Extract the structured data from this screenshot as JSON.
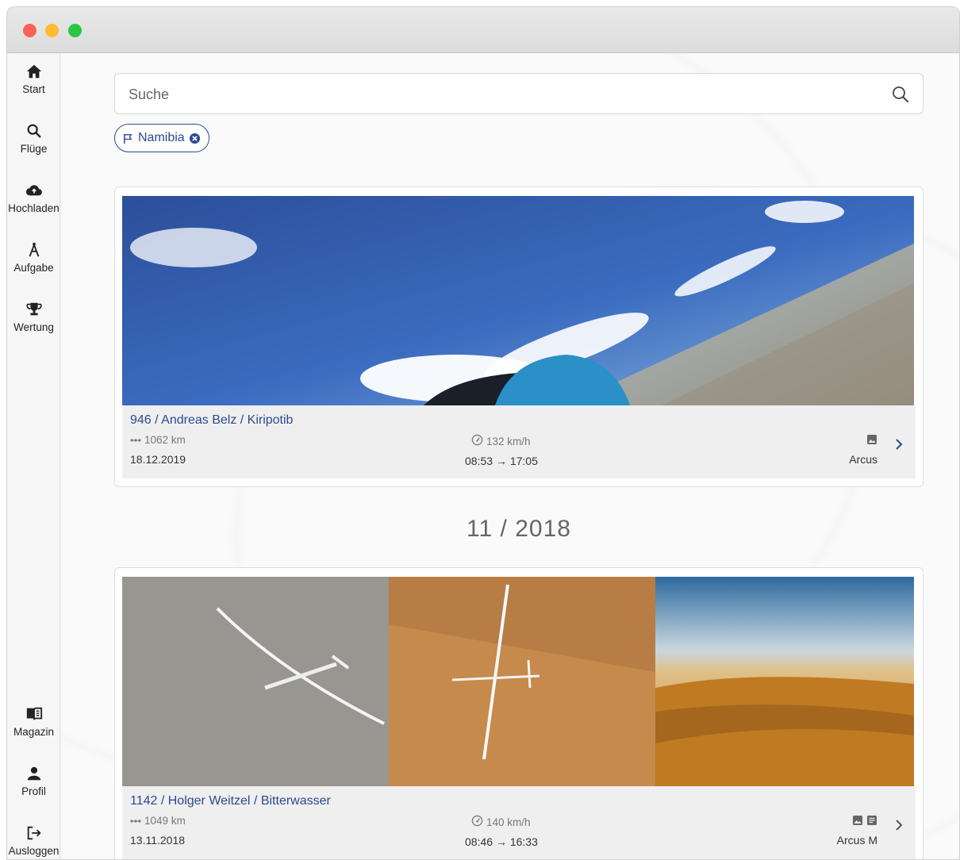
{
  "sidebar": {
    "top_items": [
      {
        "label": "Start",
        "icon": "home-icon"
      },
      {
        "label": "Flüge",
        "icon": "search-icon"
      },
      {
        "label": "Hochladen",
        "icon": "cloud-upload-icon"
      },
      {
        "label": "Aufgabe",
        "icon": "compass-icon"
      },
      {
        "label": "Wertung",
        "icon": "trophy-icon"
      }
    ],
    "bottom_items": [
      {
        "label": "Magazin",
        "icon": "book-icon"
      },
      {
        "label": "Profil",
        "icon": "user-icon"
      },
      {
        "label": "Ausloggen",
        "icon": "logout-icon"
      }
    ]
  },
  "search": {
    "placeholder": "Suche"
  },
  "filter_chip": {
    "label": "Namibia"
  },
  "month_header": "11 / 2018",
  "flights": [
    {
      "title": "946 / Andreas Belz / Kiripotib",
      "distance": "1062 km",
      "date": "18.12.2019",
      "speed": "132 km/h",
      "time_start": "08:53",
      "time_end": "17:05",
      "arrow": "→",
      "plane": "Arcus",
      "media": [
        "image-icon"
      ]
    },
    {
      "title": "1142 / Holger Weitzel / Bitterwasser",
      "distance": "1049 km",
      "date": "13.11.2018",
      "speed": "140 km/h",
      "time_start": "08:46",
      "time_end": "16:33",
      "arrow": "→",
      "plane": "Arcus M",
      "media": [
        "image-icon",
        "document-icon"
      ]
    }
  ],
  "colors": {
    "accent": "#2c4a8f"
  }
}
